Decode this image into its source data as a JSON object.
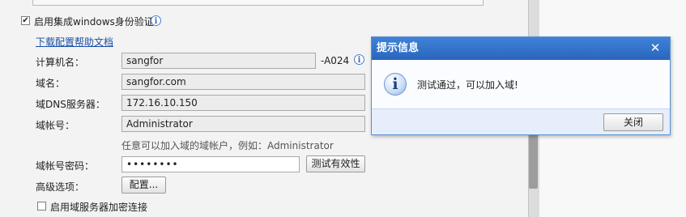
{
  "settings": {
    "integrated_auth_label": "启用集成windows身份验证",
    "integrated_auth_checked": true,
    "help_link": "下载配置帮助文档",
    "computer_name_label": "计算机名：",
    "computer_name_value": "sangfor",
    "computer_name_suffix": "-A024",
    "domain_label": "域名：",
    "domain_value": "sangfor.com",
    "dns_label": "域DNS服务器：",
    "dns_value": "172.16.10.150",
    "account_label": "域帐号：",
    "account_value": "Administrator",
    "account_hint": "任意可以加入域的域帐户，例如：Administrator",
    "password_label": "域帐号密码：",
    "password_value": "••••••••",
    "test_button": "测试有效性",
    "advanced_label": "高级选项：",
    "config_button": "配置...",
    "encrypt_label": "启用域服务器加密连接",
    "encrypt_checked": false
  },
  "dialog": {
    "title": "提示信息",
    "message": "测试通过，可以加入域!",
    "close_button": "关闭",
    "close_glyph": "✕"
  },
  "icons": {
    "info": "i",
    "check": "✔"
  },
  "colors": {
    "dialog_title": "#2f6fc9",
    "link": "#1a4fa6"
  }
}
